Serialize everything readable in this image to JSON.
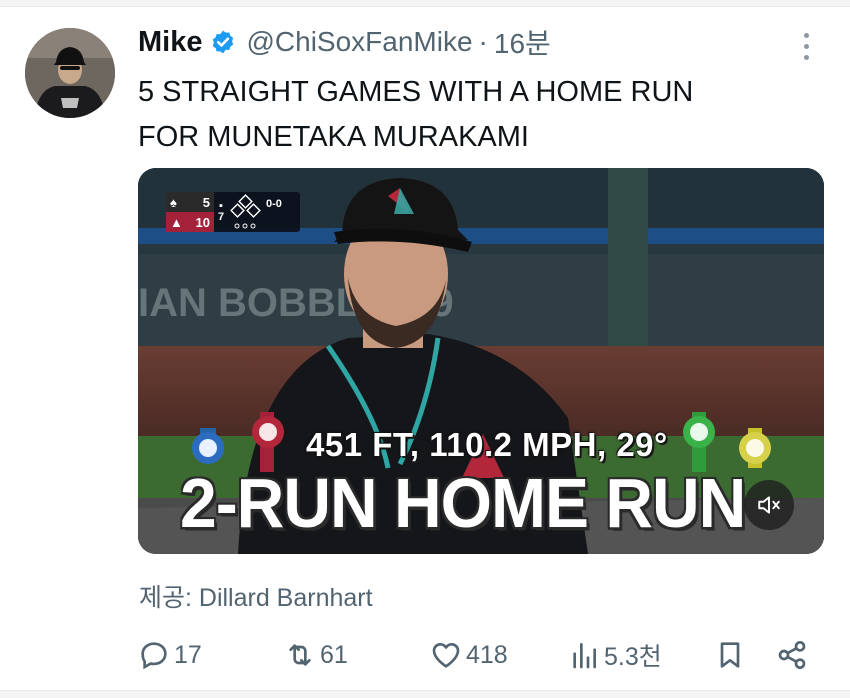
{
  "tweet": {
    "author_name": "Mike",
    "handle": "@ChiSoxFanMike",
    "separator": "·",
    "time": "16분",
    "text_lines": [
      "5 STRAIGHT GAMES WITH A HOME RUN",
      "FOR MUNETAKA MURAKAMI"
    ],
    "verified_color": "#1d9bf0"
  },
  "media": {
    "scorebug": {
      "away_score": "5",
      "home_score": "10",
      "inning": "7",
      "count": "0-0"
    },
    "wall_text": "IAN BOBBL   AY 9",
    "stat_line": "451 FT, 110.2 MPH, 29°",
    "banner": "2-RUN HOME RUN",
    "mute_icon": "volume-muted-icon"
  },
  "credit": "제공: Dillard Barnhart",
  "actions": {
    "reply": {
      "icon": "reply-icon",
      "count": "17"
    },
    "retweet": {
      "icon": "retweet-icon",
      "count": "61"
    },
    "like": {
      "icon": "heart-icon",
      "count": "418"
    },
    "views": {
      "icon": "views-icon",
      "count": "5.3천"
    },
    "bookmark": {
      "icon": "bookmark-icon"
    },
    "share": {
      "icon": "share-icon"
    }
  },
  "colors": {
    "text": "#0f1419",
    "muted": "#536471",
    "accent": "#1d9bf0"
  }
}
